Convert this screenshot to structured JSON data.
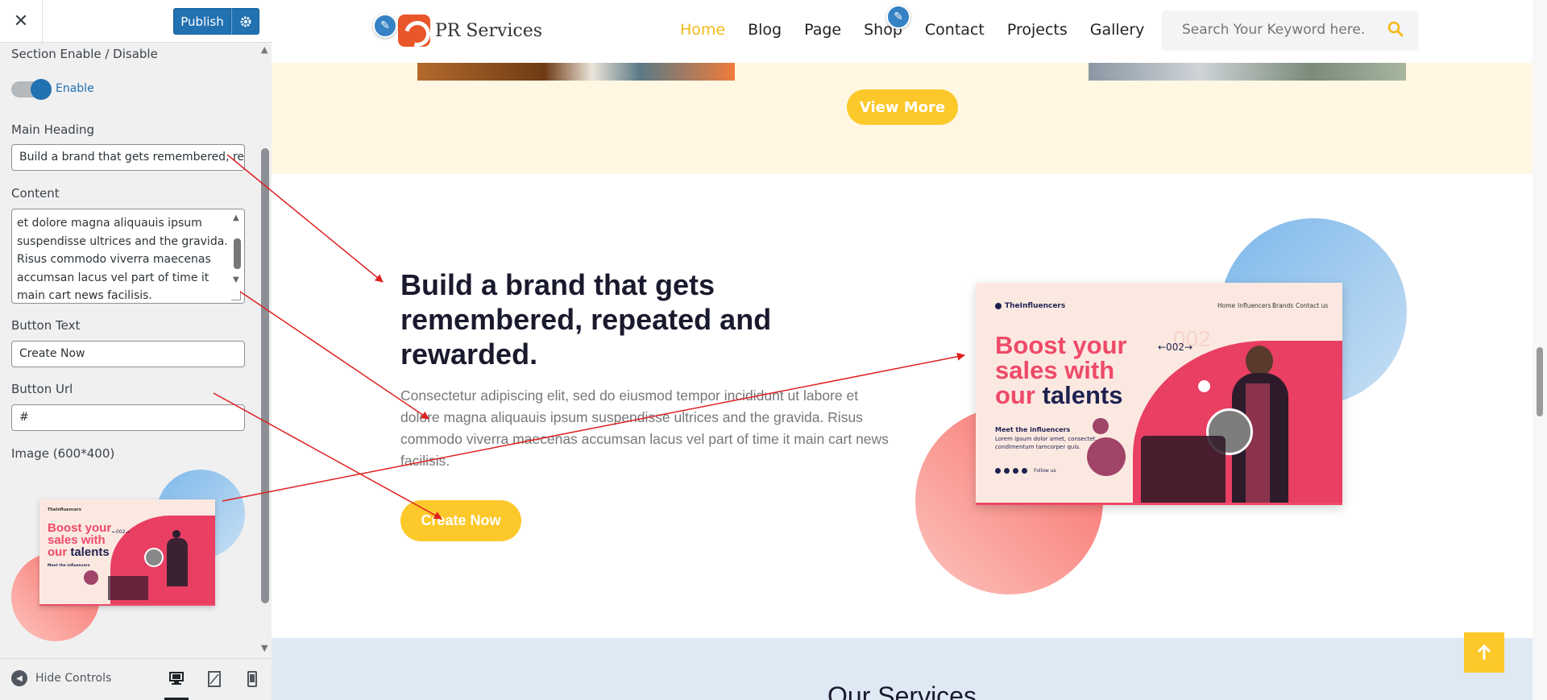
{
  "sidebar": {
    "close_label": "✕",
    "publish_label": "Publish",
    "section_label": "Section Enable / Disable",
    "toggle_label": "Enable",
    "main_heading_label": "Main Heading",
    "main_heading_value": "Build a brand that gets remembered, re",
    "content_label": "Content",
    "content_lines": [
      "et dolore magna aliquauis ipsum",
      "suspendisse ultrices and the gravida.",
      "Risus commodo viverra maecenas",
      "accumsan lacus vel part of time it",
      "main cart news facilisis."
    ],
    "button_text_label": "Button Text",
    "button_text_value": "Create Now",
    "button_url_label": "Button Url",
    "button_url_value": "#",
    "image_label": "Image (600*400)",
    "hide_controls": "Hide Controls",
    "thumb": {
      "brand": "TheInfluencers",
      "nav": [
        "Home",
        "Influencers",
        "Brands",
        "Contact us"
      ],
      "line1": "Boost your",
      "line2": "sales with",
      "line3_a": "our",
      "line3_b": "talents",
      "counter": "←002→",
      "sub_title": "Meet the influencers"
    }
  },
  "site": {
    "brand": "PR Services",
    "nav": [
      "Home",
      "Blog",
      "Page",
      "Shop",
      "Contact",
      "Projects",
      "Gallery"
    ],
    "search_placeholder": "Search Your Keyword here.",
    "view_more": "View More",
    "heading": "Build a brand that gets remembered, repeated and rewarded.",
    "paragraph": "Consectetur adipiscing elit, sed do eiusmod tempor incididunt ut labore et dolore magna aliquauis ipsum suspendisse ultrices and the gravida. Risus commodo viverra maecenas accumsan lacus vel part of time it main cart news facilisis.",
    "cta": "Create Now",
    "services_title": "Our Services",
    "mock": {
      "brand": "TheInfluencers",
      "nav": [
        "Home",
        "Influencers",
        "Brands",
        "Contact us"
      ],
      "line1": "Boost your",
      "line2": "sales with",
      "line3_a": "our",
      "line3_b": "talents",
      "counter": "←002→",
      "ghost": "002",
      "sub_title": "Meet the influencers",
      "sub_text1": "Lorem ipsum dolor amet, consectet",
      "sub_text2": "condimentum tamcorper quis.",
      "follow": "Follow us"
    }
  },
  "colors": {
    "accent_yellow": "#fcc82a",
    "wp_blue": "#2271b1",
    "pink": "#ef4a69",
    "navy": "#1e2150",
    "arrow": "#e02020"
  }
}
